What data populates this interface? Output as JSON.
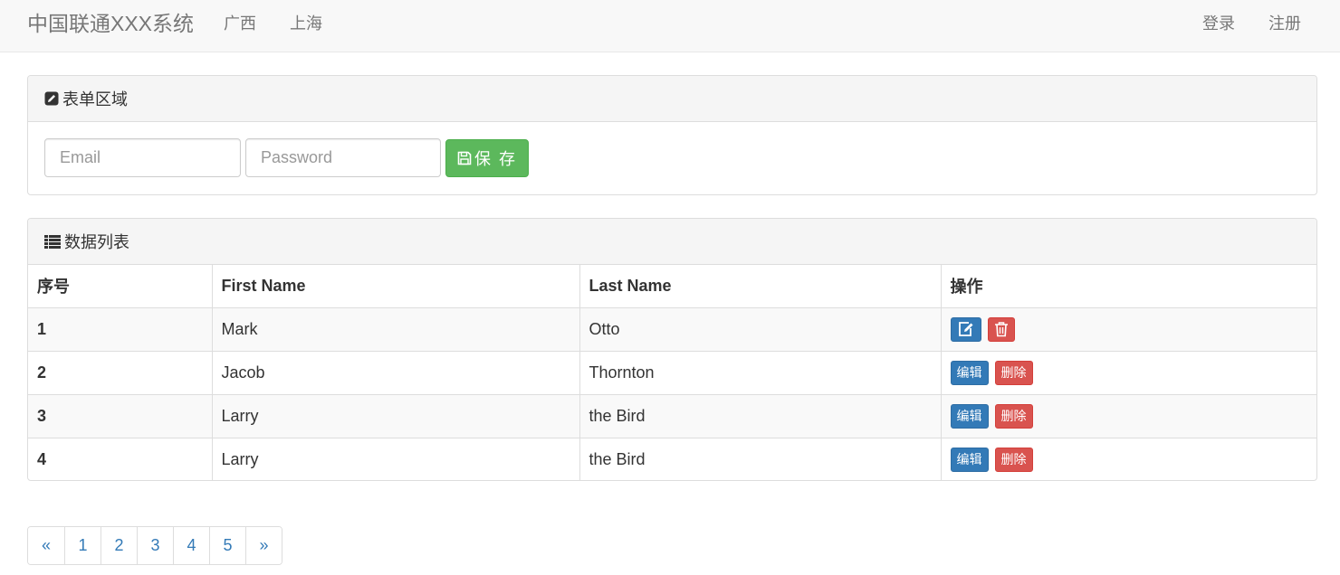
{
  "navbar": {
    "brand": "中国联通XXX系统",
    "links": [
      "广西",
      "上海"
    ],
    "login": "登录",
    "register": "注册"
  },
  "form_panel": {
    "title": "表单区域",
    "title_icon": "edit-icon",
    "email_placeholder": "Email",
    "password_placeholder": "Password",
    "save_label": "保 存",
    "save_icon": "save-icon"
  },
  "list_panel": {
    "title": "数据列表",
    "title_icon": "list-icon",
    "columns": [
      "序号",
      "First Name",
      "Last Name",
      "操作"
    ],
    "rows": [
      {
        "num": "1",
        "first": "Mark",
        "last": "Otto",
        "actions": "icons",
        "edit_icon": "edit-icon",
        "delete_icon": "trash-icon"
      },
      {
        "num": "2",
        "first": "Jacob",
        "last": "Thornton",
        "actions": "text",
        "edit": "编辑",
        "delete": "删除"
      },
      {
        "num": "3",
        "first": "Larry",
        "last": "the Bird",
        "actions": "text",
        "edit": "编辑",
        "delete": "删除"
      },
      {
        "num": "4",
        "first": "Larry",
        "last": "the Bird",
        "actions": "text",
        "edit": "编辑",
        "delete": "删除"
      }
    ]
  },
  "pagination": {
    "prev": "«",
    "pages": [
      "1",
      "2",
      "3",
      "4",
      "5"
    ],
    "next": "»"
  },
  "colors": {
    "success": "#5cb85c",
    "primary": "#337ab7",
    "danger": "#d9534f",
    "navbar_bg": "#f8f8f8"
  }
}
